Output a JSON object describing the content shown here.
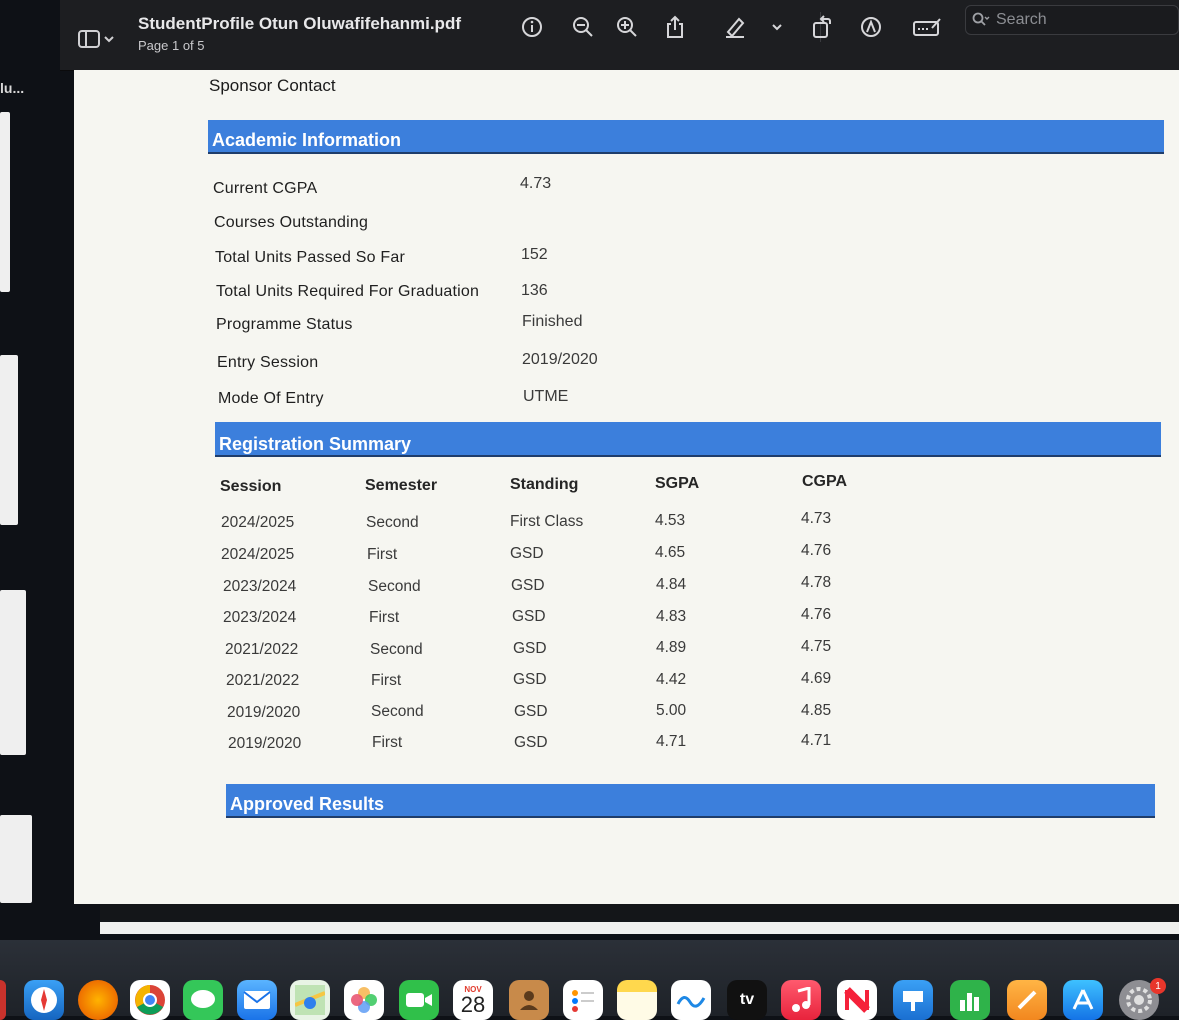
{
  "toolbar": {
    "title": "StudentProfile Otun Oluwafifehanmi.pdf",
    "page_indicator": "Page 1 of 5",
    "search_placeholder": "Search",
    "icons": [
      "sidebar-icon",
      "chevron-down-icon",
      "info-icon",
      "zoom-out-icon",
      "zoom-in-icon",
      "share-icon",
      "highlighter-icon",
      "chevron-down-icon",
      "rotate-icon",
      "markup-icon",
      "form-fill-icon",
      "search-icon"
    ]
  },
  "left_window": {
    "label": "lu..."
  },
  "page": {
    "sponsor_label": "Sponsor Contact",
    "academic": {
      "heading": "Academic Information",
      "rows": [
        {
          "label": "Current CGPA",
          "value": "4.73"
        },
        {
          "label": "Courses Outstanding",
          "value": ""
        },
        {
          "label": "Total Units Passed So Far",
          "value": "152"
        },
        {
          "label": "Total Units Required For Graduation",
          "value": "136"
        },
        {
          "label": "Programme Status",
          "value": "Finished"
        },
        {
          "label": "Entry Session",
          "value": "2019/2020"
        },
        {
          "label": "Mode Of Entry",
          "value": "UTME"
        }
      ]
    },
    "registration": {
      "heading": "Registration Summary",
      "columns": [
        "Session",
        "Semester",
        "Standing",
        "SGPA",
        "CGPA"
      ],
      "rows": [
        [
          "2024/2025",
          "Second",
          "First Class",
          "4.53",
          "4.73"
        ],
        [
          "2024/2025",
          "First",
          "GSD",
          "4.65",
          "4.76"
        ],
        [
          "2023/2024",
          "Second",
          "GSD",
          "4.84",
          "4.78"
        ],
        [
          "2023/2024",
          "First",
          "GSD",
          "4.83",
          "4.76"
        ],
        [
          "2021/2022",
          "Second",
          "GSD",
          "4.89",
          "4.75"
        ],
        [
          "2021/2022",
          "First",
          "GSD",
          "4.42",
          "4.69"
        ],
        [
          "2019/2020",
          "Second",
          "GSD",
          "5.00",
          "4.85"
        ],
        [
          "2019/2020",
          "First",
          "GSD",
          "4.71",
          "4.71"
        ]
      ]
    },
    "approved": {
      "heading": "Approved Results"
    }
  },
  "dock": {
    "apps": [
      "Safari",
      "Firefox",
      "Chrome",
      "Messages",
      "Mail",
      "Maps",
      "Photos",
      "FaceTime",
      "Calendar",
      "Contacts",
      "Reminders",
      "Notes",
      "Freeform",
      "TV",
      "Music",
      "News",
      "Keynote",
      "Numbers",
      "Pages",
      "App Store",
      "System Settings"
    ],
    "calendar": {
      "month": "NOV",
      "day": "28"
    },
    "tv_label": "tv",
    "settings_badge": "1"
  },
  "colors": {
    "section_bar": "#3c7fdc",
    "toolbar": "#1d1e21",
    "page": "#f6f6f1"
  }
}
